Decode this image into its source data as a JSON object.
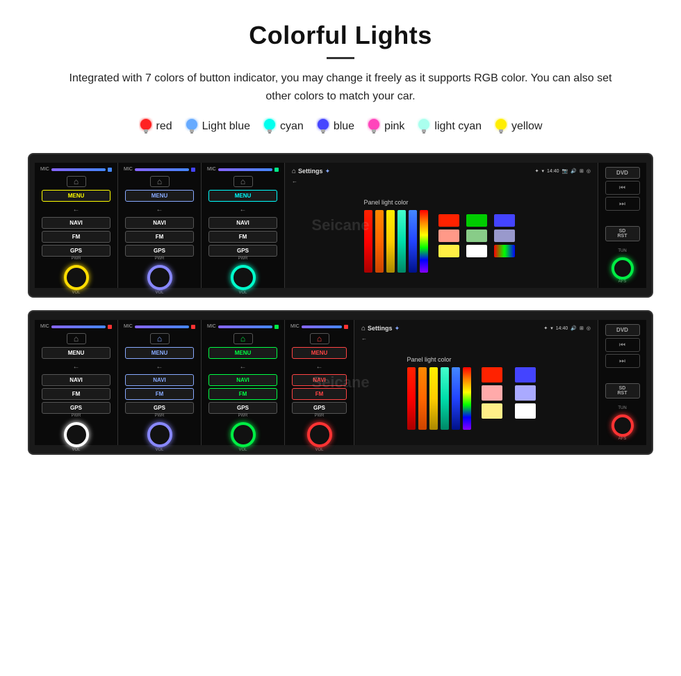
{
  "header": {
    "title": "Colorful Lights",
    "description": "Integrated with 7 colors of button indicator, you may change it freely as it supports RGB color. You can also set other colors to match your car."
  },
  "colors": [
    {
      "name": "red",
      "color": "#ff2222",
      "glow": "#ff0000"
    },
    {
      "name": "Light blue",
      "color": "#66aaff",
      "glow": "#4488ff"
    },
    {
      "name": "cyan",
      "color": "#00ffee",
      "glow": "#00ddcc"
    },
    {
      "name": "blue",
      "color": "#4444ff",
      "glow": "#2222ff"
    },
    {
      "name": "pink",
      "color": "#ff44bb",
      "glow": "#ff22aa"
    },
    {
      "name": "light cyan",
      "color": "#aaffee",
      "glow": "#88ffdd"
    },
    {
      "name": "yellow",
      "color": "#ffee00",
      "glow": "#ffcc00"
    }
  ],
  "unit1": {
    "menu_color": "yellow",
    "knob_color": "yellow",
    "knob_class": "knob-yellow"
  },
  "unit2": {
    "menu_color": "blue",
    "knob_color": "blue",
    "knob_class": "knob-blue"
  },
  "unit3": {
    "menu_color": "cyan",
    "knob_color": "cyan",
    "knob_class": "knob-cyan"
  },
  "display": {
    "title": "Settings",
    "time": "14:40",
    "panel_light_label": "Panel light color"
  },
  "swatches_top": [
    "#ff0000",
    "#00cc00",
    "#4444ff",
    "#ff8888",
    "#88cc88",
    "#aaaadd",
    "#ffcc44",
    "#ffffff",
    "#ff00ff"
  ],
  "swatches_bottom": [
    "#ff0000",
    "#0000ff",
    "#ffaaaa",
    "#aaaaff",
    "#ffee88",
    "#ffffff"
  ],
  "watermark": "Seicane",
  "row2": {
    "unit1_knob": "knob-white",
    "unit2_knob": "knob-blue",
    "unit3_knob": "knob-green",
    "unit4_knob": "knob-red",
    "right_knob": "knob-red"
  }
}
